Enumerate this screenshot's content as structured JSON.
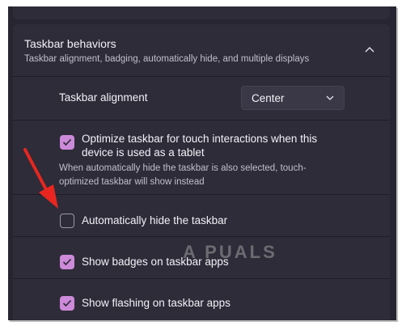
{
  "section": {
    "title": "Taskbar behaviors",
    "subtitle": "Taskbar alignment, badging, automatically hide, and multiple displays",
    "expanded": true
  },
  "alignment": {
    "label": "Taskbar alignment",
    "selected": "Center"
  },
  "options": [
    {
      "label_line1": "Optimize taskbar for touch interactions when this",
      "label_line2": "device is used as a tablet",
      "sub_line1": "When automatically hide the taskbar is also selected, touch-",
      "sub_line2": "optimized taskbar will show instead",
      "checked": true
    },
    {
      "label": "Automatically hide the taskbar",
      "checked": false
    },
    {
      "label": "Show badges on taskbar apps",
      "checked": true
    },
    {
      "label": "Show flashing on taskbar apps",
      "checked": true
    }
  ],
  "watermark": "A PUALS",
  "colors": {
    "accent": "#cc8ad8",
    "background": "#272531",
    "card": "#2e2c39",
    "annotation_arrow": "#e8261f"
  }
}
